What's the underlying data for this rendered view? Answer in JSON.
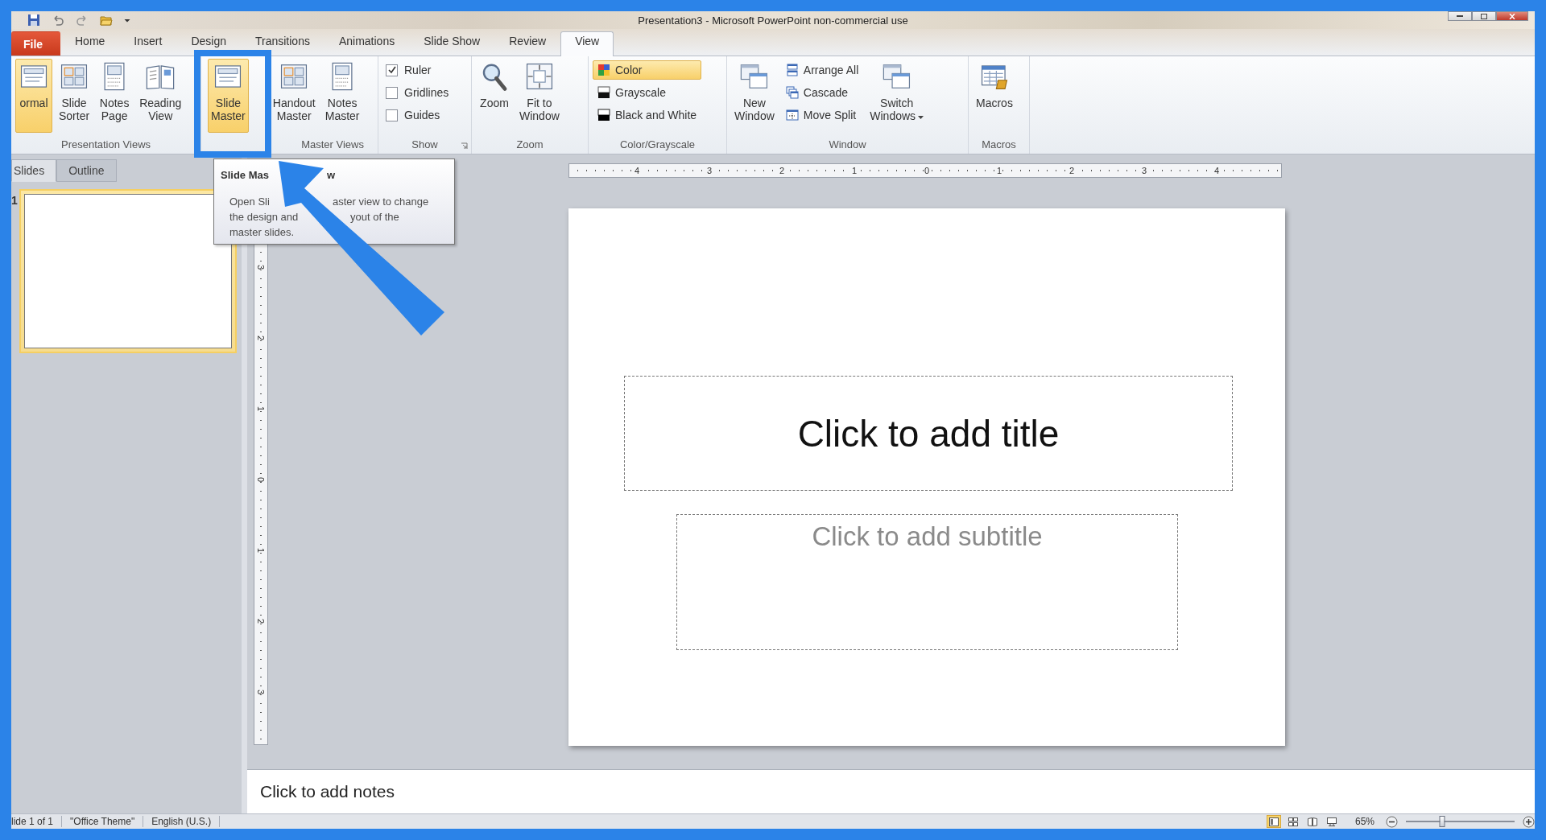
{
  "title_bar": {
    "title": "Presentation3  -  Microsoft PowerPoint non-commercial use"
  },
  "tabs": [
    {
      "label": "File",
      "kind": "file",
      "selected": false
    },
    {
      "label": "Home",
      "kind": "tab",
      "selected": false
    },
    {
      "label": "Insert",
      "kind": "tab",
      "selected": false
    },
    {
      "label": "Design",
      "kind": "tab",
      "selected": false
    },
    {
      "label": "Transitions",
      "kind": "tab",
      "selected": false
    },
    {
      "label": "Animations",
      "kind": "tab",
      "selected": false
    },
    {
      "label": "Slide Show",
      "kind": "tab",
      "selected": false
    },
    {
      "label": "Review",
      "kind": "tab",
      "selected": false
    },
    {
      "label": "View",
      "kind": "tab",
      "selected": true
    }
  ],
  "ribbon": {
    "groups": [
      {
        "label": "Presentation Views",
        "items": [
          {
            "kind": "large",
            "label": "ormal",
            "selected": true
          },
          {
            "kind": "large",
            "label": "Slide\nSorter",
            "selected": false
          },
          {
            "kind": "large",
            "label": "Notes\nPage",
            "selected": false
          },
          {
            "kind": "large",
            "label": "Reading\nView",
            "selected": false
          }
        ]
      },
      {
        "label": "Master Views",
        "items": [
          {
            "kind": "large",
            "label": "Slide\nMaster",
            "selected": true
          },
          {
            "kind": "large",
            "label": "Handout\nMaster",
            "selected": false
          },
          {
            "kind": "large",
            "label": "Notes\nMaster",
            "selected": false
          }
        ]
      },
      {
        "label": "Show",
        "launcher": true,
        "items": [
          {
            "kind": "check",
            "label": "Ruler",
            "checked": true
          },
          {
            "kind": "check",
            "label": "Gridlines",
            "checked": false
          },
          {
            "kind": "check",
            "label": "Guides",
            "checked": false
          }
        ]
      },
      {
        "label": "Zoom",
        "items": [
          {
            "kind": "large",
            "label": "Zoom",
            "selected": false
          },
          {
            "kind": "large",
            "label": "Fit to\nWindow",
            "selected": false
          }
        ]
      },
      {
        "label": "Color/Grayscale",
        "items": [
          {
            "kind": "small",
            "label": "Color",
            "selected": true
          },
          {
            "kind": "small",
            "label": "Grayscale",
            "selected": false
          },
          {
            "kind": "small",
            "label": "Black and White",
            "selected": false
          }
        ]
      },
      {
        "label": "Window",
        "items": [
          {
            "kind": "large",
            "label": "New\nWindow",
            "selected": false
          },
          {
            "kind": "small",
            "label": "Arrange All",
            "selected": false
          },
          {
            "kind": "small",
            "label": "Cascade",
            "selected": false
          },
          {
            "kind": "small",
            "label": "Move Split",
            "selected": false
          },
          {
            "kind": "large",
            "label": "Switch\nWindows",
            "dropdown": true,
            "selected": false
          }
        ]
      },
      {
        "label": "Macros",
        "items": [
          {
            "kind": "large",
            "label": "Macros",
            "selected": false
          }
        ]
      }
    ]
  },
  "slides_pane": {
    "tabs": [
      {
        "label": "Slides",
        "selected": true
      },
      {
        "label": "Outline",
        "selected": false
      }
    ],
    "thumbnails": [
      {
        "number": "1",
        "selected": true
      }
    ]
  },
  "tooltip": {
    "title_parts": [
      "Slide Mas",
      "w"
    ],
    "lines": [
      [
        "Open Sli",
        "aster view to change"
      ],
      [
        "the design and",
        "yout of the"
      ],
      [
        "master slides."
      ]
    ]
  },
  "horizontal_ruler": [
    "4",
    "3",
    "2",
    "1",
    "0",
    "1",
    "2",
    "3",
    "4"
  ],
  "vertical_ruler": [
    "3",
    "2",
    "1",
    "0",
    "1",
    "2",
    "3"
  ],
  "slide": {
    "title_placeholder": "Click to add title",
    "subtitle_placeholder": "Click to add subtitle"
  },
  "notes": {
    "placeholder": "Click to add notes"
  },
  "status_bar": {
    "items": [
      "lide 1 of 1",
      "\"Office Theme\"",
      "English (U.S.)"
    ],
    "view_buttons": [
      {
        "selected": true
      },
      {
        "selected": false
      },
      {
        "selected": false
      },
      {
        "selected": false
      }
    ],
    "zoom": "65%",
    "zoom_slider": {
      "level": 0.33
    }
  }
}
